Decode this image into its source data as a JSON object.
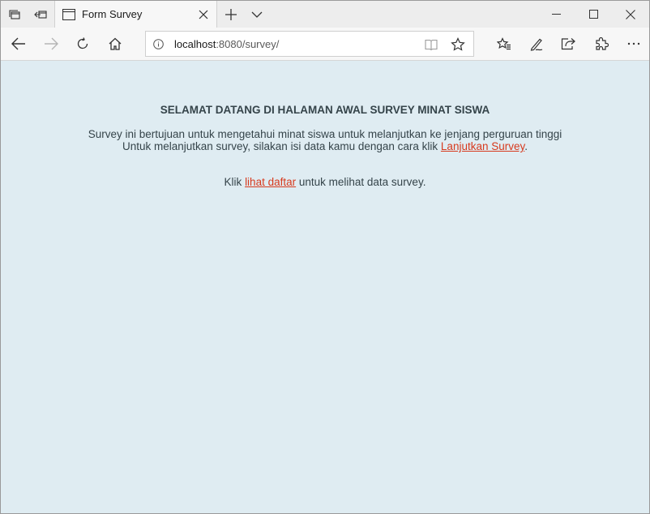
{
  "browser": {
    "tab": {
      "title": "Form Survey"
    },
    "address": {
      "host": "localhost",
      "rest": ":8080/survey/"
    },
    "icons": {
      "tab_manager": "tabs-aside-icon",
      "set_aside": "set-tabs-aside-icon",
      "new_tab": "plus-icon",
      "tab_list": "chevron-down-icon",
      "back": "arrow-left-icon",
      "forward": "arrow-right-icon",
      "refresh": "refresh-icon",
      "home": "home-icon",
      "favorites": "favorites-icon",
      "notes": "pen-icon",
      "share": "share-icon",
      "extensions": "puzzle-icon",
      "more": "more-icon"
    }
  },
  "page": {
    "heading": "SELAMAT DATANG DI HALAMAN AWAL SURVEY MINAT SISWA",
    "intro_line1": "Survey ini bertujuan untuk mengetahui minat siswa untuk melanjutkan ke jenjang perguruan tinggi",
    "intro_line2_prefix": "Untuk melanjutkan survey, silakan isi data kamu dengan cara klik ",
    "continue_link": "Lanjutkan Survey",
    "intro_line2_suffix": ".",
    "list_prefix": "Klik ",
    "list_link": "lihat daftar",
    "list_suffix": " untuk melihat data survey.",
    "link_color": "#d73a1e",
    "background_color": "#dfecf2"
  }
}
